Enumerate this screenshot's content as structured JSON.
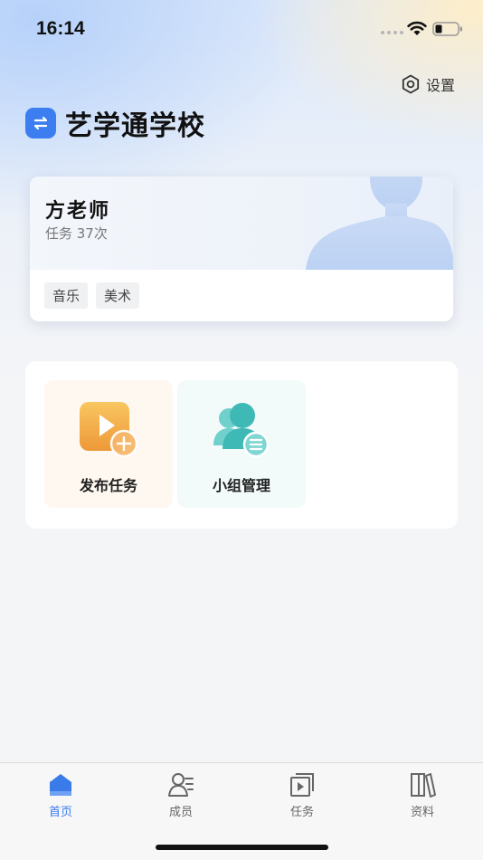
{
  "status_bar": {
    "time": "16:14"
  },
  "header": {
    "settings_label": "设置",
    "school_name": "艺学通学校"
  },
  "teacher_card": {
    "name": "方老师",
    "stats": "任务 37次",
    "tags": [
      "音乐",
      "美术"
    ]
  },
  "functions": [
    {
      "label": "发布任务",
      "icon": "video-add-icon",
      "color": "#f0a43c"
    },
    {
      "label": "小组管理",
      "icon": "group-list-icon",
      "color": "#3fc0bd"
    }
  ],
  "bottom_nav": {
    "active_color": "#3a7bea",
    "items": [
      {
        "label": "首页",
        "icon": "home-icon",
        "active": true
      },
      {
        "label": "成员",
        "icon": "members-icon",
        "active": false
      },
      {
        "label": "任务",
        "icon": "task-icon",
        "active": false
      },
      {
        "label": "资料",
        "icon": "library-icon",
        "active": false
      }
    ]
  }
}
